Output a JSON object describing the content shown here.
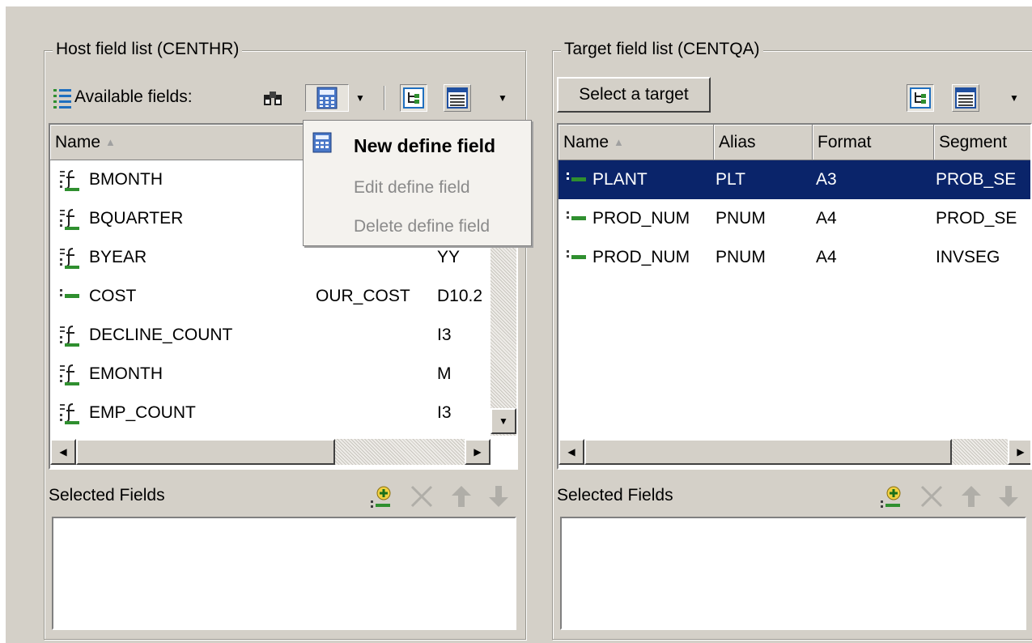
{
  "host_panel": {
    "title": "Host field list (CENTHR)",
    "available_label": "Available fields:",
    "columns": [
      "Name",
      "",
      ""
    ],
    "rows": [
      {
        "name": "BMONTH",
        "alias": "",
        "format": "",
        "icon": "define-field-icon"
      },
      {
        "name": "BQUARTER",
        "alias": "",
        "format": "",
        "icon": "define-field-icon"
      },
      {
        "name": "BYEAR",
        "alias": "",
        "format": "YY",
        "icon": "define-field-icon"
      },
      {
        "name": "COST",
        "alias": "OUR_COST",
        "format": "D10.2",
        "icon": "field-icon"
      },
      {
        "name": "DECLINE_COUNT",
        "alias": "",
        "format": "I3",
        "icon": "define-field-icon"
      },
      {
        "name": "EMONTH",
        "alias": "",
        "format": "M",
        "icon": "define-field-icon"
      },
      {
        "name": "EMP_COUNT",
        "alias": "",
        "format": "I3",
        "icon": "define-field-icon"
      }
    ],
    "selected_label": "Selected Fields"
  },
  "context_menu": {
    "items": [
      {
        "label": "New define field",
        "enabled": true
      },
      {
        "label": "Edit define field",
        "enabled": false
      },
      {
        "label": "Delete define field",
        "enabled": false
      }
    ]
  },
  "target_panel": {
    "title": "Target field list (CENTQA)",
    "select_button": "Select a target",
    "columns": [
      "Name",
      "Alias",
      "Format",
      "Segment"
    ],
    "rows": [
      {
        "name": "PLANT",
        "alias": "PLT",
        "format": "A3",
        "segment": "PROB_SE",
        "selected": true
      },
      {
        "name": "PROD_NUM",
        "alias": "PNUM",
        "format": "A4",
        "segment": "PROD_SE",
        "selected": false
      },
      {
        "name": "PROD_NUM",
        "alias": "PNUM",
        "format": "A4",
        "segment": "INVSEG",
        "selected": false
      }
    ],
    "selected_label": "Selected Fields"
  },
  "colors": {
    "selection": "#0a246a",
    "window_bg": "#d4d0c8"
  }
}
